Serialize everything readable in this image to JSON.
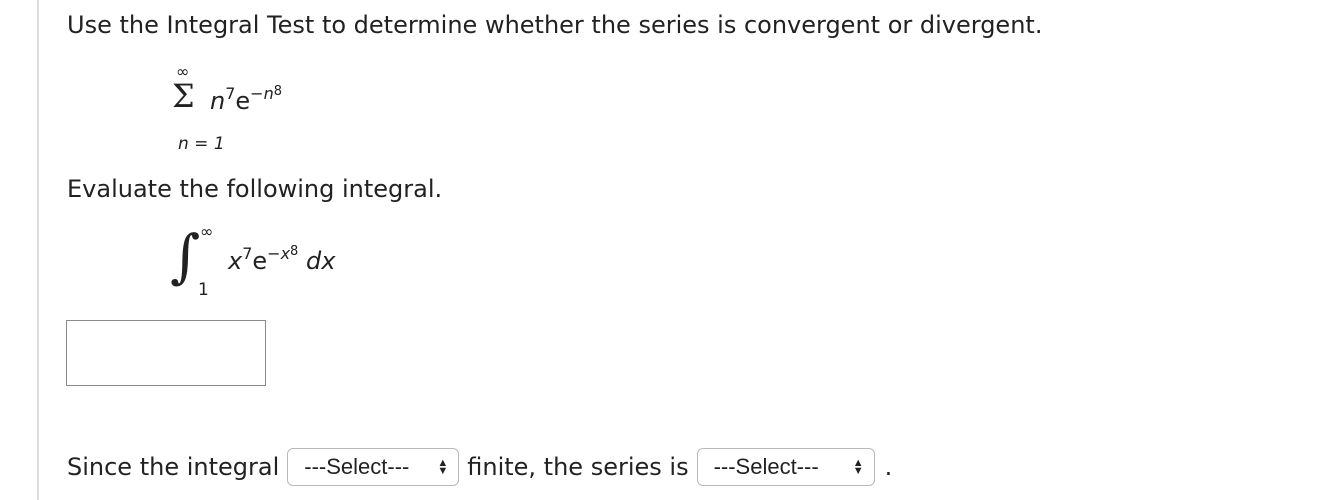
{
  "question": "Use the Integral Test to determine whether the series is convergent or divergent.",
  "series": {
    "upper_limit": "∞",
    "sigma": "Σ",
    "base": "n",
    "base_exponent": "7",
    "exp_base": "e",
    "exp_power_sign": "−",
    "exp_power_var": "n",
    "exp_power_exponent": "8",
    "lower_limit": "n = 1"
  },
  "prompt": "Evaluate the following integral.",
  "integral": {
    "sign": "∫",
    "upper_limit": "∞",
    "lower_limit": "1",
    "base": "x",
    "base_exponent": "7",
    "exp_base": "e",
    "exp_power_sign": "−",
    "exp_power_var": "x",
    "exp_power_exponent": "8",
    "differential": "dx"
  },
  "answer_input": {
    "value": "",
    "placeholder": ""
  },
  "conclusion": {
    "prefix": "Since the integral",
    "select1": "---Select---",
    "middle": "finite, the series is",
    "select2": "---Select---",
    "suffix": "."
  },
  "icons": {
    "select_arrows": "up-down-arrows-icon"
  }
}
